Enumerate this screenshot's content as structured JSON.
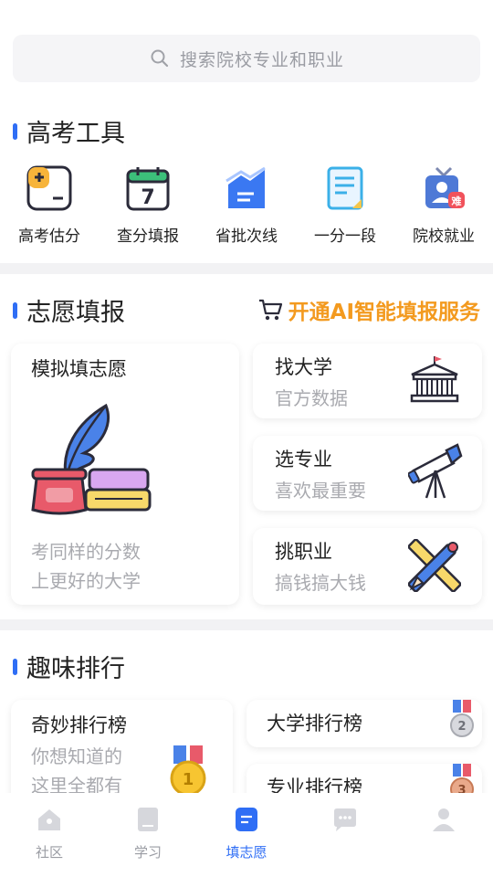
{
  "search": {
    "placeholder": "搜索院校专业和职业"
  },
  "sections": {
    "tools_title": "高考工具",
    "volunteer_title": "志愿填报",
    "ranking_title": "趣味排行"
  },
  "tools": [
    {
      "label": "高考估分",
      "icon": "calculator-icon"
    },
    {
      "label": "查分填报",
      "icon": "calendar-icon"
    },
    {
      "label": "省批次线",
      "icon": "chart-icon"
    },
    {
      "label": "一分一段",
      "icon": "document-icon"
    },
    {
      "label": "院校就业",
      "icon": "badge-icon"
    }
  ],
  "ai_service": {
    "label": "开通AI智能填报服务"
  },
  "volunteer": {
    "main": {
      "title": "模拟填志愿",
      "sub_1": "考同样的分数",
      "sub_2": "上更好的大学"
    },
    "find_university": {
      "title": "找大学",
      "sub": "官方数据"
    },
    "choose_major": {
      "title": "选专业",
      "sub": "喜欢最重要"
    },
    "pick_career": {
      "title": "挑职业",
      "sub": "搞钱搞大钱"
    }
  },
  "ranking": {
    "main": {
      "title": "奇妙排行榜",
      "sub_1": "你想知道的",
      "sub_2": "这里全都有"
    },
    "university": {
      "title": "大学排行榜"
    },
    "major": {
      "title": "专业排行榜"
    }
  },
  "medals": {
    "gold": "1",
    "silver": "2",
    "bronze": "3"
  },
  "tabbar": [
    {
      "label": "社区",
      "icon": "home-icon"
    },
    {
      "label": "学习",
      "icon": "book-icon"
    },
    {
      "label": "填志愿",
      "icon": "form-icon"
    },
    {
      "label": "",
      "icon": "chat-icon"
    },
    {
      "label": "",
      "icon": "user-icon"
    }
  ],
  "colors": {
    "accent": "#2f6ef5",
    "orange": "#f39a1f",
    "divider": "#f2f2f4"
  }
}
